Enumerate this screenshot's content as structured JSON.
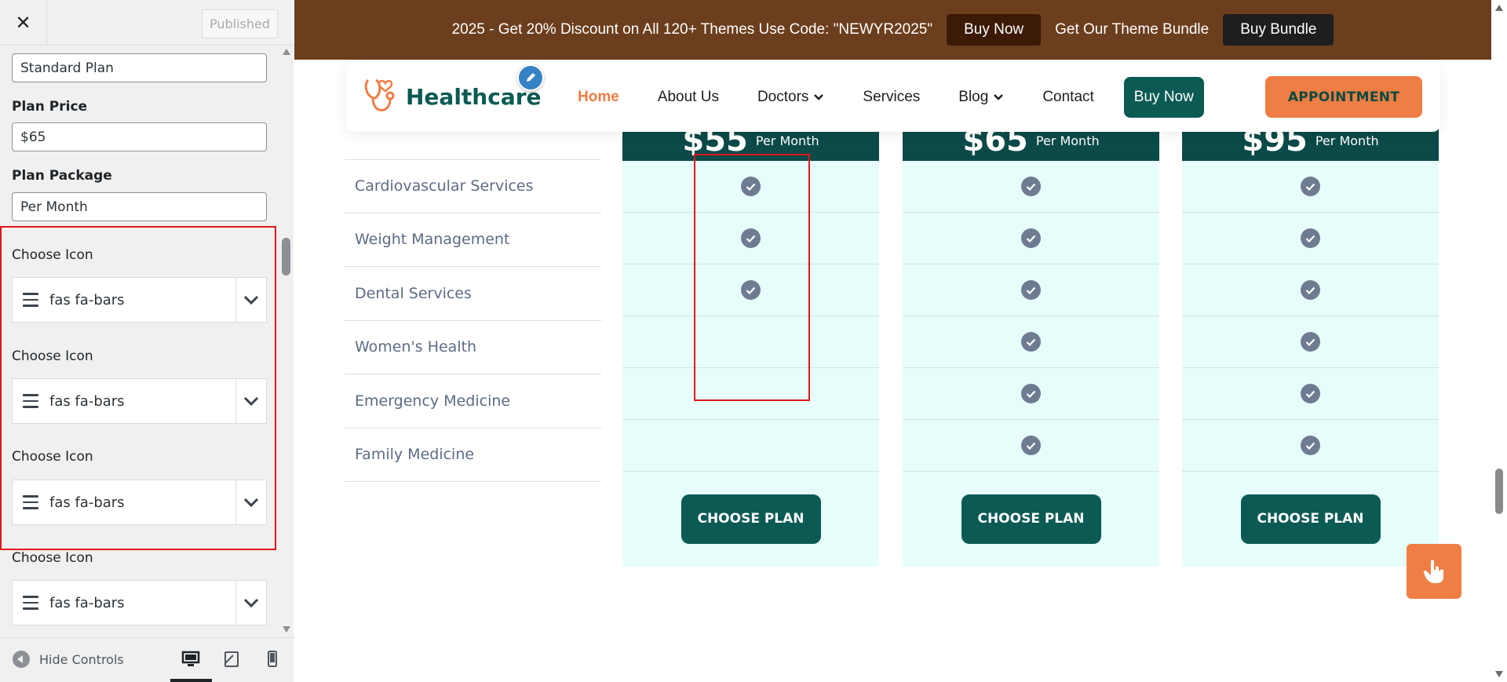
{
  "sidebar": {
    "close_glyph": "✕",
    "published_label": "Published",
    "plan_name_value": "Standard Plan",
    "plan_price_label": "Plan Price",
    "plan_price_value": "$65",
    "plan_package_label": "Plan Package",
    "plan_package_value": "Per Month",
    "icon_pickers": [
      {
        "label": "Choose Icon",
        "value": "fas fa-bars"
      },
      {
        "label": "Choose Icon",
        "value": "fas fa-bars"
      },
      {
        "label": "Choose Icon",
        "value": "fas fa-bars"
      },
      {
        "label": "Choose Icon",
        "value": "fas fa-bars"
      }
    ],
    "hide_controls_label": "Hide Controls",
    "devices": [
      "desktop-icon",
      "tablet-icon",
      "mobile-icon"
    ],
    "active_device": "desktop"
  },
  "promo": {
    "text": "2025 - Get 20% Discount on All 120+ Themes Use Code: \"NEWYR2025\"",
    "buy_now": "Buy Now",
    "bundle_text": "Get Our Theme Bundle",
    "buy_bundle": "Buy Bundle"
  },
  "nav": {
    "logo": "Healthcare",
    "items": [
      {
        "label": "Home",
        "active": true
      },
      {
        "label": "About Us"
      },
      {
        "label": "Doctors",
        "dropdown": true
      },
      {
        "label": "Services"
      },
      {
        "label": "Blog",
        "dropdown": true
      },
      {
        "label": "Contact"
      }
    ],
    "buy_now": "Buy Now",
    "appointment": "APPOINTMENT"
  },
  "pricing": {
    "features": [
      "Cardiovascular Services",
      "Weight Management",
      "Dental Services",
      "Women's Health",
      "Emergency Medicine",
      "Family Medicine"
    ],
    "plans": [
      {
        "price": "$55",
        "package": "Per Month",
        "checks": [
          true,
          true,
          true,
          false,
          false,
          false
        ],
        "cta": "CHOOSE PLAN"
      },
      {
        "price": "$65",
        "package": "Per Month",
        "checks": [
          true,
          true,
          true,
          true,
          true,
          true
        ],
        "cta": "CHOOSE PLAN"
      },
      {
        "price": "$95",
        "package": "Per Month",
        "checks": [
          true,
          true,
          true,
          true,
          true,
          true
        ],
        "cta": "CHOOSE PLAN"
      }
    ]
  },
  "colors": {
    "brand_teal": "#0b5a54",
    "accent_orange": "#ef7e44",
    "promo_brown": "#6b3e1d",
    "highlight_red": "#e0161b",
    "plan_bg": "#e6fdfc"
  }
}
